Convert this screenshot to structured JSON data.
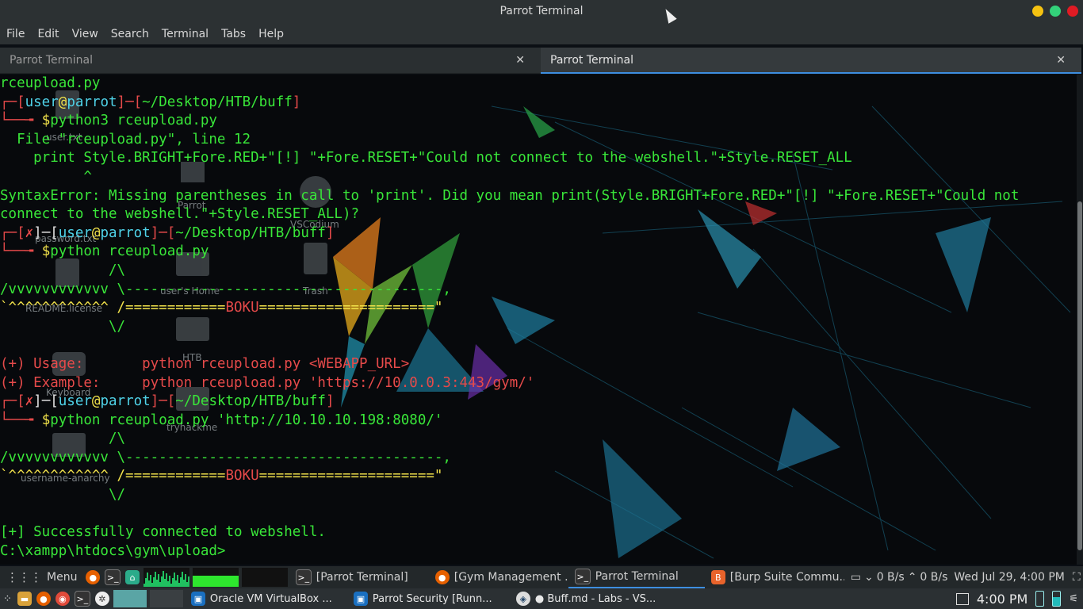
{
  "window": {
    "title": "Parrot Terminal"
  },
  "menu": [
    "File",
    "Edit",
    "View",
    "Search",
    "Terminal",
    "Tabs",
    "Help"
  ],
  "tabs": [
    {
      "label": "Parrot Terminal",
      "active": false
    },
    {
      "label": "Parrot Terminal",
      "active": true
    }
  ],
  "terminal": {
    "lines": [
      [
        [
          "rceupload.py",
          "g"
        ]
      ],
      [
        [
          "┌─[",
          "r"
        ],
        [
          "user",
          "c"
        ],
        [
          "@",
          "y"
        ],
        [
          "parrot",
          "c"
        ],
        [
          "]─[",
          "r"
        ],
        [
          "~/Desktop/HTB/buff",
          "g"
        ],
        [
          "]",
          "r"
        ]
      ],
      [
        [
          "└──╼ ",
          "r"
        ],
        [
          "$",
          "y"
        ],
        [
          "python3 rceupload.py",
          "g"
        ]
      ],
      [
        [
          "  File \"rceupload.py\", line 12",
          "g"
        ]
      ],
      [
        [
          "    print Style.BRIGHT+Fore.RED+\"[!] \"+Fore.RESET+\"Could not connect to the webshell.\"+Style.RESET_ALL",
          "g"
        ]
      ],
      [
        [
          "          ^",
          "g"
        ]
      ],
      [
        [
          "SyntaxError: Missing parentheses in call to 'print'. Did you mean print(Style.BRIGHT+Fore.RED+\"[!] \"+Fore.RESET+\"Could not",
          "g"
        ]
      ],
      [
        [
          "connect to the webshell.\"+Style.RESET_ALL)?",
          "g"
        ]
      ],
      [
        [
          "┌─[",
          "r"
        ],
        [
          "✗",
          "r"
        ],
        [
          "]─[",
          "w"
        ],
        [
          "user",
          "c"
        ],
        [
          "@",
          "y"
        ],
        [
          "parrot",
          "c"
        ],
        [
          "]─[",
          "r"
        ],
        [
          "~/Desktop/HTB/buff",
          "g"
        ],
        [
          "]",
          "r"
        ]
      ],
      [
        [
          "└──╼ ",
          "r"
        ],
        [
          "$",
          "y"
        ],
        [
          "python rceupload.py",
          "g"
        ]
      ],
      [
        [
          "             /\\",
          "g"
        ]
      ],
      [
        [
          "/vvvvvvvvvvvv \\--------------------------------------,",
          "g"
        ]
      ],
      [
        [
          "`^^^^^^^^^^^^ /============",
          "y"
        ],
        [
          "BOKU",
          "r"
        ],
        [
          "=====================\"",
          "y"
        ]
      ],
      [
        [
          "             \\/",
          "g"
        ]
      ],
      [
        [
          "",
          "g"
        ]
      ],
      [
        [
          "(+) Usage:       python rceupload.py <WEBAPP_URL>",
          "r"
        ]
      ],
      [
        [
          "(+) Example:     python rceupload.py 'https://10.0.0.3:443/gym/'",
          "r"
        ]
      ],
      [
        [
          "┌─[",
          "r"
        ],
        [
          "✗",
          "r"
        ],
        [
          "]─[",
          "w"
        ],
        [
          "user",
          "c"
        ],
        [
          "@",
          "y"
        ],
        [
          "parrot",
          "c"
        ],
        [
          "]─[",
          "r"
        ],
        [
          "~/Desktop/HTB/buff",
          "g"
        ],
        [
          "]",
          "r"
        ]
      ],
      [
        [
          "└──╼ ",
          "r"
        ],
        [
          "$",
          "y"
        ],
        [
          "python rceupload.py 'http://10.10.10.198:8080/'",
          "g"
        ]
      ],
      [
        [
          "             /\\",
          "g"
        ]
      ],
      [
        [
          "/vvvvvvvvvvvv \\--------------------------------------,",
          "g"
        ]
      ],
      [
        [
          "`^^^^^^^^^^^^ /============",
          "y"
        ],
        [
          "BOKU",
          "r"
        ],
        [
          "=====================\"",
          "y"
        ]
      ],
      [
        [
          "             \\/",
          "g"
        ]
      ],
      [
        [
          "",
          "g"
        ]
      ],
      [
        [
          "[+] Successfully connected to webshell.",
          "g"
        ]
      ],
      [
        [
          "C:\\xampp\\htdocs\\gym\\upload>",
          "g"
        ]
      ]
    ]
  },
  "desktop_icons": [
    {
      "label": "user.txt"
    },
    {
      "label": "Parrot"
    },
    {
      "label": "VSCodium"
    },
    {
      "label": "password.txt"
    },
    {
      "label": "user's Home"
    },
    {
      "label": "Trash"
    },
    {
      "label": "README.license"
    },
    {
      "label": "HTB"
    },
    {
      "label": "Keyboard"
    },
    {
      "label": "tryhackme"
    },
    {
      "label": "username-anarchy"
    }
  ],
  "taskbar_top": {
    "menu_label": "Menu",
    "windows": [
      {
        "label": "[Parrot Terminal]",
        "icon": "terminal-icon",
        "active": false
      },
      {
        "label": "[Gym Management ...",
        "icon": "firefox-icon",
        "active": false
      },
      {
        "label": "Parrot Terminal",
        "icon": "terminal-icon",
        "active": true
      },
      {
        "label": "[Burp Suite Commu...",
        "icon": "burp-icon",
        "active": false
      }
    ],
    "net_down": "0 B/s",
    "net_up": "0 B/s",
    "clock": "Wed Jul 29,  4:00 PM"
  },
  "taskbar_bottom": {
    "windows": [
      {
        "label": "Oracle VM VirtualBox ...",
        "icon": "virtualbox-icon"
      },
      {
        "label": "Parrot Security [Runn...",
        "icon": "virtualbox-icon"
      },
      {
        "label": "● Buff.md - Labs - VS...",
        "icon": "vscode-icon"
      }
    ],
    "time": "4:00 PM"
  },
  "colors": {
    "green": "#39e639",
    "red": "#e64a4a",
    "cyan": "#4fd2e8",
    "yellow": "#f3e34b",
    "accent": "#3d8ee0"
  }
}
